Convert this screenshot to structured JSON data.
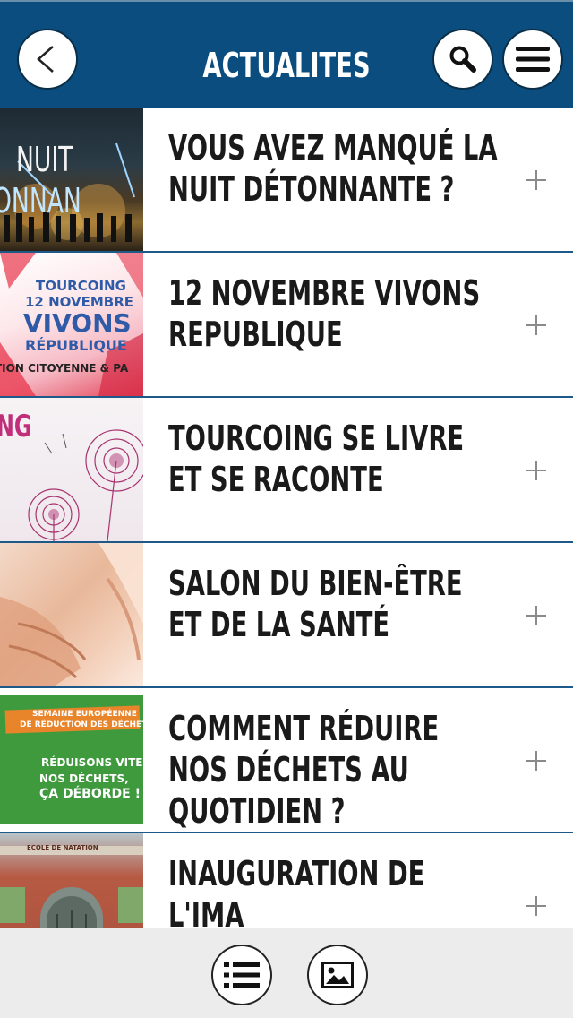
{
  "header": {
    "title": "ACTUALITES",
    "back_icon": "chevron-left-icon",
    "search_icon": "search-icon",
    "menu_icon": "hamburger-menu-icon",
    "background": "#0a4d7e"
  },
  "news": [
    {
      "title": "VOUS AVEZ MANQUÉ LA NUIT DÉTONNANTE ?",
      "thumb_text": [
        "NUIT",
        "ONNAN"
      ]
    },
    {
      "title": "12 NOVEMBRE VIVONS REPUBLIQUE",
      "thumb_text": [
        "TOURCOING",
        "12 NOVEMBRE",
        "VIVONS",
        "RÉPUBLIQUE",
        "TION CITOYENNE & PA"
      ]
    },
    {
      "title": "TOURCOING SE LIVRE ET SE RACONTE",
      "thumb_text": [
        "NG"
      ]
    },
    {
      "title": "SALON DU BIEN-ÊTRE ET DE LA SANTÉ",
      "thumb_text": []
    },
    {
      "title": "COMMENT RÉDUIRE NOS DÉCHETS AU QUOTIDIEN ?",
      "thumb_text": [
        "SEMAINE EUROPÉENNE",
        "DE RÉDUCTION DES DÉCHETS",
        "RÉDUISONS VITE",
        "NOS DÉCHETS,",
        "ÇA DÉBORDE !"
      ]
    },
    {
      "title": "INAUGURATION DE L'IMA",
      "thumb_text": [
        "ECOLE DE NATATION"
      ]
    }
  ],
  "footer": {
    "list_icon": "list-view-icon",
    "gallery_icon": "image-gallery-icon"
  }
}
